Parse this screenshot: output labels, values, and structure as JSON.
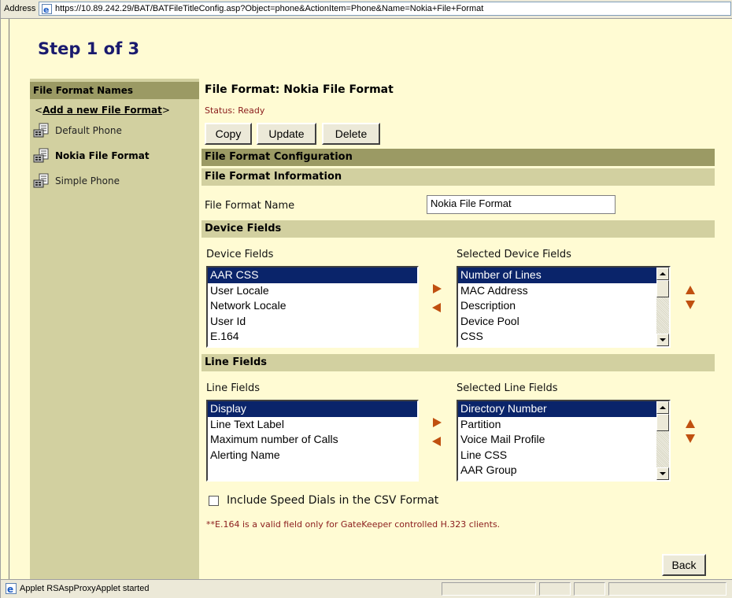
{
  "address": {
    "label": "Address",
    "url": "https://10.89.242.29/BAT/BATFileTitleConfig.asp?Object=phone&ActionItem=Phone&Name=Nokia+File+Format"
  },
  "page": {
    "step_title": "Step 1 of 3"
  },
  "sidebar": {
    "heading": "File Format Names",
    "add_prefix": "<",
    "add_link": "Add a new File Format",
    "add_suffix": ">",
    "items": [
      {
        "label": "Default Phone",
        "icon": "phone-icon"
      },
      {
        "label": "Nokia File Format",
        "icon": "phone-icon"
      },
      {
        "label": "Simple Phone",
        "icon": "phone-icon"
      }
    ]
  },
  "main": {
    "file_format_title": "File Format:  Nokia File Format",
    "status": "Status: Ready",
    "buttons": {
      "copy": "Copy",
      "update": "Update",
      "delete": "Delete",
      "back": "Back"
    },
    "config_header": "File Format Configuration",
    "info_header": "File Format Information",
    "name_label": "File Format Name",
    "name_value": "Nokia File Format",
    "device_section": "Device Fields",
    "device_left_label": "Device Fields",
    "device_right_label": "Selected Device Fields",
    "device_fields": [
      "AAR CSS",
      "User Locale",
      "Network Locale",
      "User Id",
      "E.164"
    ],
    "selected_device_fields": [
      "Number of Lines",
      "MAC Address",
      "Description",
      "Device Pool",
      "CSS"
    ],
    "line_section": "Line Fields",
    "line_left_label": "Line Fields",
    "line_right_label": "Selected Line Fields",
    "line_fields": [
      "Display",
      "Line Text Label",
      "Maximum number of Calls",
      "Alerting Name"
    ],
    "selected_line_fields": [
      "Directory Number",
      "Partition",
      "Voice Mail Profile",
      "Line CSS",
      "AAR Group"
    ],
    "speed_dial_label": "Include Speed Dials in the CSV Format",
    "speed_dial_checked": false,
    "note": "**E.164 is a valid field only for GateKeeper controlled H.323 clients."
  },
  "statusbar": {
    "text": "Applet RSAspProxyApplet started"
  },
  "colors": {
    "accent_dark": "#9b9a64",
    "accent_light": "#d2d0a0",
    "background": "#fffbd3",
    "selected": "#0a246a",
    "arrow": "#c05010"
  }
}
